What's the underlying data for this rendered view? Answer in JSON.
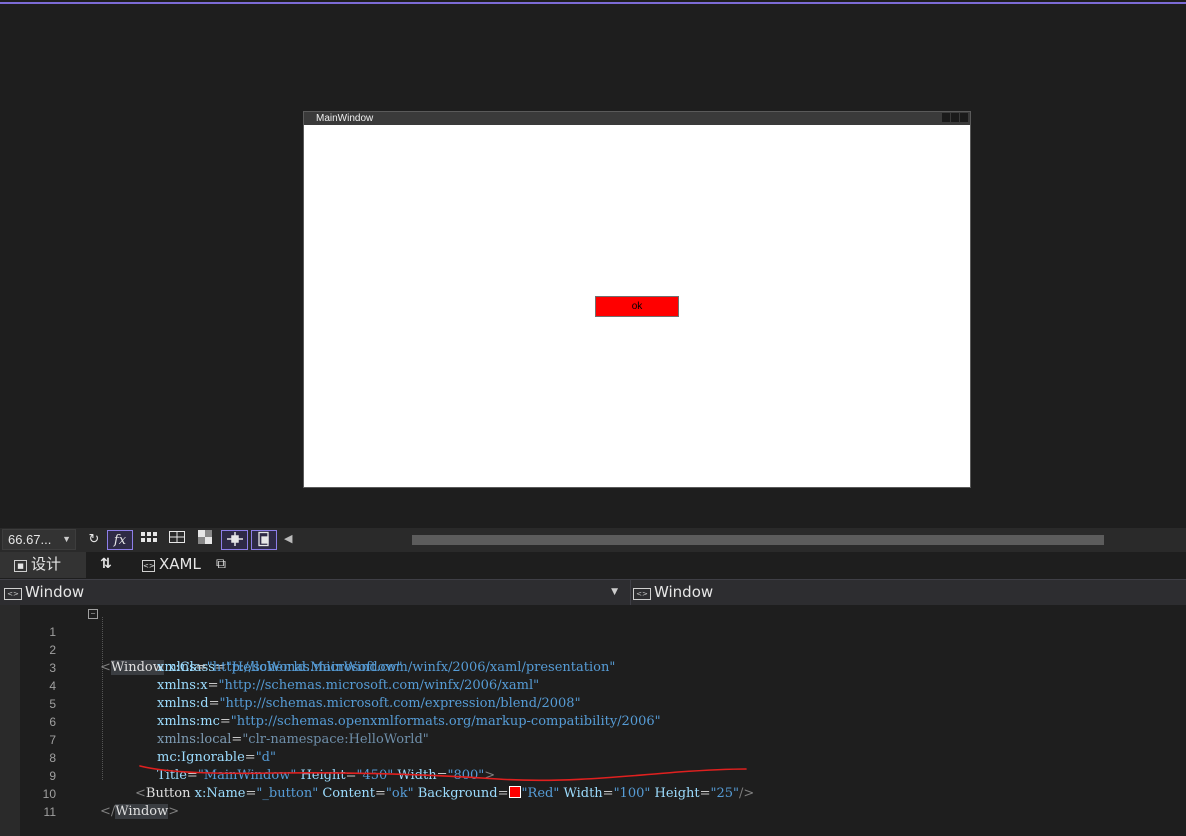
{
  "designer": {
    "window_title": "MainWindow",
    "button_content": "ok",
    "button_background": "#ff0000"
  },
  "toolbar": {
    "zoom": "66.67...",
    "fx_label": "fx"
  },
  "tabs": {
    "design": "设计",
    "xaml": "XAML"
  },
  "nav": {
    "left": "Window",
    "right": "Window"
  },
  "editor": {
    "line_numbers": [
      "1",
      "2",
      "3",
      "4",
      "5",
      "6",
      "7",
      "8",
      "9",
      "10",
      "11"
    ],
    "lines": {
      "l1": {
        "elem": "Window",
        "attr": "x:Class",
        "val": "\"HelloWorld.MainWindow\""
      },
      "l2": {
        "attr": "xmlns",
        "val": "\"http://schemas.microsoft.com/winfx/2006/xaml/presentation\""
      },
      "l3": {
        "attr": "xmlns:x",
        "val": "\"http://schemas.microsoft.com/winfx/2006/xaml\""
      },
      "l4": {
        "attr": "xmlns:d",
        "val": "\"http://schemas.microsoft.com/expression/blend/2008\""
      },
      "l5": {
        "attr": "xmlns:mc",
        "val": "\"http://schemas.openxmlformats.org/markup-compatibility/2006\""
      },
      "l6": {
        "attr": "xmlns:local",
        "val": "\"clr-namespace:HelloWorld\""
      },
      "l7": {
        "attr": "mc:Ignorable",
        "val": "\"d\""
      },
      "l8": {
        "attr1": "Title",
        "val1": "\"MainWindow\"",
        "attr2": "Height",
        "val2": "\"450\"",
        "attr3": "Width",
        "val3": "\"800\""
      },
      "l9": {
        "elem": "Button",
        "attr1": "x:Name",
        "val1": "\"_button\"",
        "attr2": "Content",
        "val2": "\"ok\"",
        "attr3": "Background",
        "val3": "\"Red\"",
        "attr4": "Width",
        "val4": "\"100\"",
        "attr5": "Height",
        "val5": "\"25\""
      },
      "l10": {
        "elem": "Window"
      }
    }
  },
  "colors": {
    "accent": "#7c6bd6",
    "annotation": "#e0201f"
  }
}
